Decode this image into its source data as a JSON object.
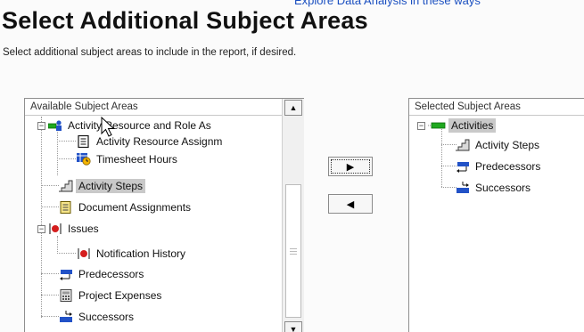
{
  "page": {
    "top_link_fragment": "Explore Data Analysis in these ways",
    "title": "Select Additional Subject Areas",
    "subtitle": "Select additional subject areas to include in the report, if desired."
  },
  "available": {
    "header": "Available Subject Areas",
    "items": [
      {
        "label": "Activity Resource and Role As",
        "icon": "resource-role-icon",
        "expanded": true
      },
      {
        "label": "Activity Resource Assignm",
        "icon": "document-icon"
      },
      {
        "label": "Timesheet Hours",
        "icon": "timesheet-icon"
      },
      {
        "label": "Activity Steps",
        "icon": "steps-icon",
        "selected": true
      },
      {
        "label": "Document Assignments",
        "icon": "document-assignment-icon"
      },
      {
        "label": "Issues",
        "icon": "issues-icon",
        "expanded": true
      },
      {
        "label": "Notification History",
        "icon": "issues-icon"
      },
      {
        "label": "Predecessors",
        "icon": "predecessor-icon"
      },
      {
        "label": "Project Expenses",
        "icon": "expenses-icon"
      },
      {
        "label": "Successors",
        "icon": "successor-icon"
      }
    ]
  },
  "selected": {
    "header": "Selected Subject Areas",
    "items": [
      {
        "label": "Activities",
        "icon": "activities-icon",
        "expanded": true,
        "selected": true
      },
      {
        "label": "Activity Steps",
        "icon": "steps-icon"
      },
      {
        "label": "Predecessors",
        "icon": "predecessor-icon"
      },
      {
        "label": "Successors",
        "icon": "successor-icon"
      }
    ]
  },
  "buttons": {
    "move_right": "▶",
    "move_left": "◀"
  },
  "scrollbar": {
    "up": "▲",
    "down": "▼"
  },
  "tree": {
    "collapse_symbol": "−"
  },
  "colors": {
    "title": "#111111",
    "selection": "#c9c9c9",
    "green_icon": "#1fa81f",
    "blue_icon": "#2252c7",
    "red_icon": "#d41e1e"
  }
}
